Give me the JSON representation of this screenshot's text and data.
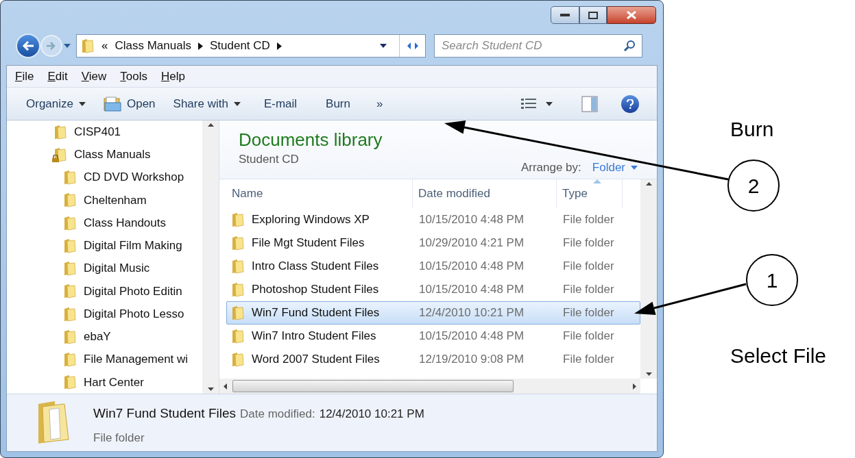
{
  "address": {
    "overflow": "«",
    "crumbs": [
      "Class Manuals",
      "Student CD"
    ]
  },
  "search": {
    "placeholder": "Search Student CD"
  },
  "menu": [
    "File",
    "Edit",
    "View",
    "Tools",
    "Help"
  ],
  "commands": [
    {
      "label": "Organize",
      "kind": "menu"
    },
    {
      "label": "Open",
      "kind": "open"
    },
    {
      "label": "Share with",
      "kind": "menu"
    },
    {
      "label": "E-mail",
      "kind": "plain"
    },
    {
      "label": "Burn",
      "kind": "plain"
    },
    {
      "label": "»",
      "kind": "more"
    }
  ],
  "nav": {
    "items": [
      {
        "label": "CISP401",
        "locked": false
      },
      {
        "label": "Class Manuals",
        "locked": true,
        "children": [
          {
            "label": "CD DVD Workshop",
            "locked": false
          },
          {
            "label": "Cheltenham",
            "locked": false
          },
          {
            "label": "Class Handouts",
            "locked": false
          },
          {
            "label": "Digital Film Making",
            "locked": false
          },
          {
            "label": "Digital Music",
            "locked": false
          },
          {
            "label": "Digital Photo Editin",
            "locked": false
          },
          {
            "label": "Digital Photo Lesso",
            "locked": false
          },
          {
            "label": "ebaY",
            "locked": false
          },
          {
            "label": "File Management wi",
            "locked": false
          },
          {
            "label": "Hart Center",
            "locked": false
          }
        ]
      }
    ]
  },
  "library": {
    "title": "Documents library",
    "subtitle": "Student CD",
    "arrange_label": "Arrange by:",
    "arrange_value": "Folder"
  },
  "table": {
    "columns": [
      {
        "label": "Name",
        "sorted": false
      },
      {
        "label": "Date modified",
        "sorted": false
      },
      {
        "label": "Type",
        "sorted": true
      }
    ],
    "rows": [
      {
        "name": "Exploring Windows XP",
        "date": "10/15/2010 4:48 PM",
        "type": "File folder",
        "selected": false
      },
      {
        "name": "File Mgt Student Files",
        "date": "10/29/2010 4:21 PM",
        "type": "File folder",
        "selected": false
      },
      {
        "name": "Intro Class Student Files",
        "date": "10/15/2010 4:48 PM",
        "type": "File folder",
        "selected": false
      },
      {
        "name": "Photoshop Student Files",
        "date": "10/15/2010 4:48 PM",
        "type": "File folder",
        "selected": false
      },
      {
        "name": "Win7 Fund Student Files",
        "date": "12/4/2010 10:21 PM",
        "type": "File folder",
        "selected": true
      },
      {
        "name": "Win7 Intro Student Files",
        "date": "10/15/2010 4:48 PM",
        "type": "File folder",
        "selected": false
      },
      {
        "name": "Word 2007 Student Files",
        "date": "12/19/2010 9:08 PM",
        "type": "File folder",
        "selected": false
      }
    ]
  },
  "details": {
    "name": "Win7 Fund Student Files",
    "date_label": "Date modified:",
    "date": "12/4/2010 10:21 PM",
    "type": "File folder"
  },
  "annotations": [
    {
      "number": "2",
      "label": "Burn"
    },
    {
      "number": "1",
      "label": "Select File"
    }
  ]
}
